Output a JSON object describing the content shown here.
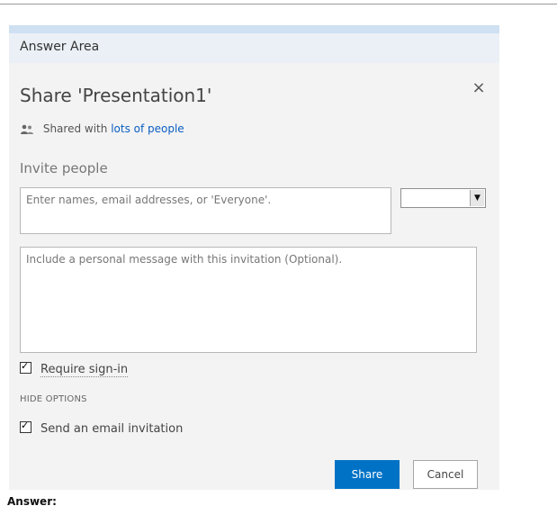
{
  "answer_area": {
    "title": "Answer Area"
  },
  "dialog": {
    "title": "Share 'Presentation1'",
    "close_glyph": "×",
    "shared_prefix": "Shared with",
    "shared_link": "lots of people",
    "invite_label": "Invite people",
    "names_placeholder": "Enter names, email addresses, or 'Everyone'.",
    "permission_value": "",
    "select_arrow": "▼",
    "message_placeholder": "Include a personal message with this invitation (Optional).",
    "require_signin": {
      "label": "Require sign-in",
      "checked": true
    },
    "hide_options": "HIDE OPTIONS",
    "send_email": {
      "label": "Send an email invitation",
      "checked": true
    },
    "share_label": "Share",
    "cancel_label": "Cancel"
  },
  "footer": {
    "label": "Answer:"
  },
  "colors": {
    "accent": "#0072c6",
    "link": "#0a5ec2",
    "answer_bar": "#eaf0f6"
  },
  "icons": {
    "shared": "people-icon",
    "close": "close-icon",
    "dropdown": "chevron-down-icon",
    "check": "checkmark-icon"
  }
}
